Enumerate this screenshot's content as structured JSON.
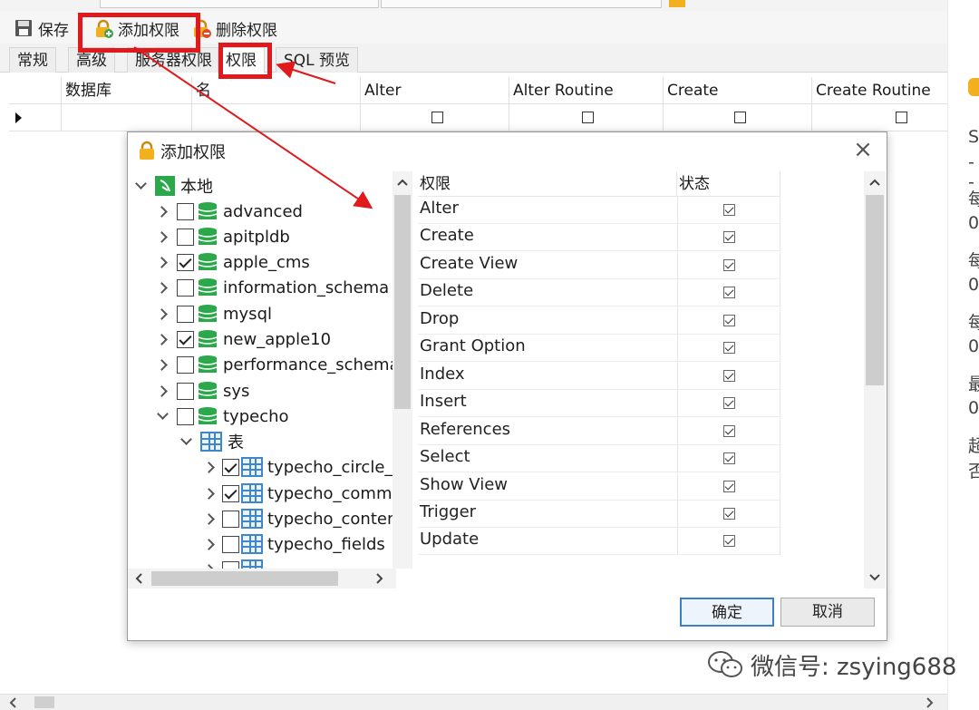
{
  "toolbar": {
    "save_label": "保存",
    "add_privilege_label": "添加权限",
    "delete_privilege_label": "删除权限"
  },
  "tabs": [
    {
      "label": "常规"
    },
    {
      "label": "高级"
    },
    {
      "label": "服务器权限"
    },
    {
      "label": "权限"
    },
    {
      "label": "SQL 预览"
    }
  ],
  "grid": {
    "columns": [
      "数据库",
      "名",
      "Alter",
      "Alter Routine",
      "Create",
      "Create Routine"
    ]
  },
  "dialog": {
    "title": "添加权限",
    "tree": {
      "root": "本地",
      "databases": [
        {
          "name": "advanced",
          "checked": false
        },
        {
          "name": "apitpldb",
          "checked": false
        },
        {
          "name": "apple_cms",
          "checked": true
        },
        {
          "name": "information_schema",
          "checked": false
        },
        {
          "name": "mysql",
          "checked": false
        },
        {
          "name": "new_apple10",
          "checked": true
        },
        {
          "name": "performance_schema",
          "checked": false
        },
        {
          "name": "sys",
          "checked": false
        },
        {
          "name": "typecho",
          "checked": false
        }
      ],
      "tables_node": "表",
      "tables": [
        {
          "name": "typecho_circle_f",
          "checked": true
        },
        {
          "name": "typecho_comme",
          "checked": true
        },
        {
          "name": "typecho_conten",
          "checked": false
        },
        {
          "name": "typecho_fields",
          "checked": false
        }
      ]
    },
    "privilege_header": "权限",
    "status_header": "状态",
    "privileges": [
      "Alter",
      "Create",
      "Create View",
      "Delete",
      "Drop",
      "Grant Option",
      "Index",
      "Insert",
      "References",
      "Select",
      "Show View",
      "Trigger",
      "Update"
    ],
    "ok_label": "确定",
    "cancel_label": "取消"
  },
  "right_panel": {
    "chars": [
      "S",
      "--",
      "每",
      "0",
      "每",
      "0",
      "每",
      "0",
      "最",
      "0",
      "超",
      "否"
    ]
  },
  "watermark": {
    "text": "微信号: zsying688"
  },
  "colors": {
    "highlight": "#e0191c",
    "db_icon": "#2aa84a",
    "primary_button_border": "#3c7fc4"
  }
}
